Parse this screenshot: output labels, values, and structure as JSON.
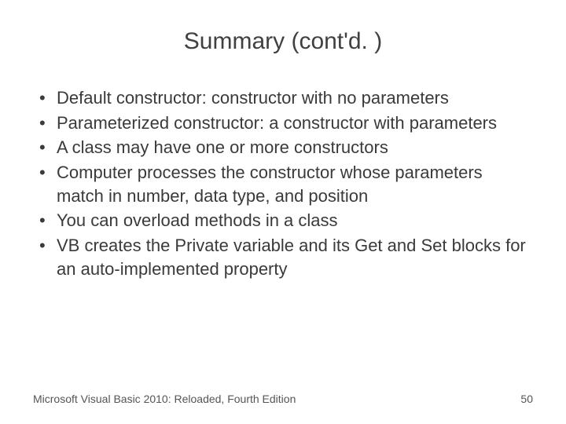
{
  "title": "Summary (cont'd. )",
  "bullets": [
    "Default constructor: constructor with no parameters",
    "Parameterized constructor: a constructor with parameters",
    "A class may have one or more constructors",
    "Computer processes the constructor whose parameters match in number, data type, and position",
    "You can overload methods in a class",
    "VB creates the Private variable and its Get and Set blocks for an auto-implemented property"
  ],
  "footer": {
    "left": "Microsoft Visual Basic 2010: Reloaded, Fourth Edition",
    "right": "50"
  }
}
